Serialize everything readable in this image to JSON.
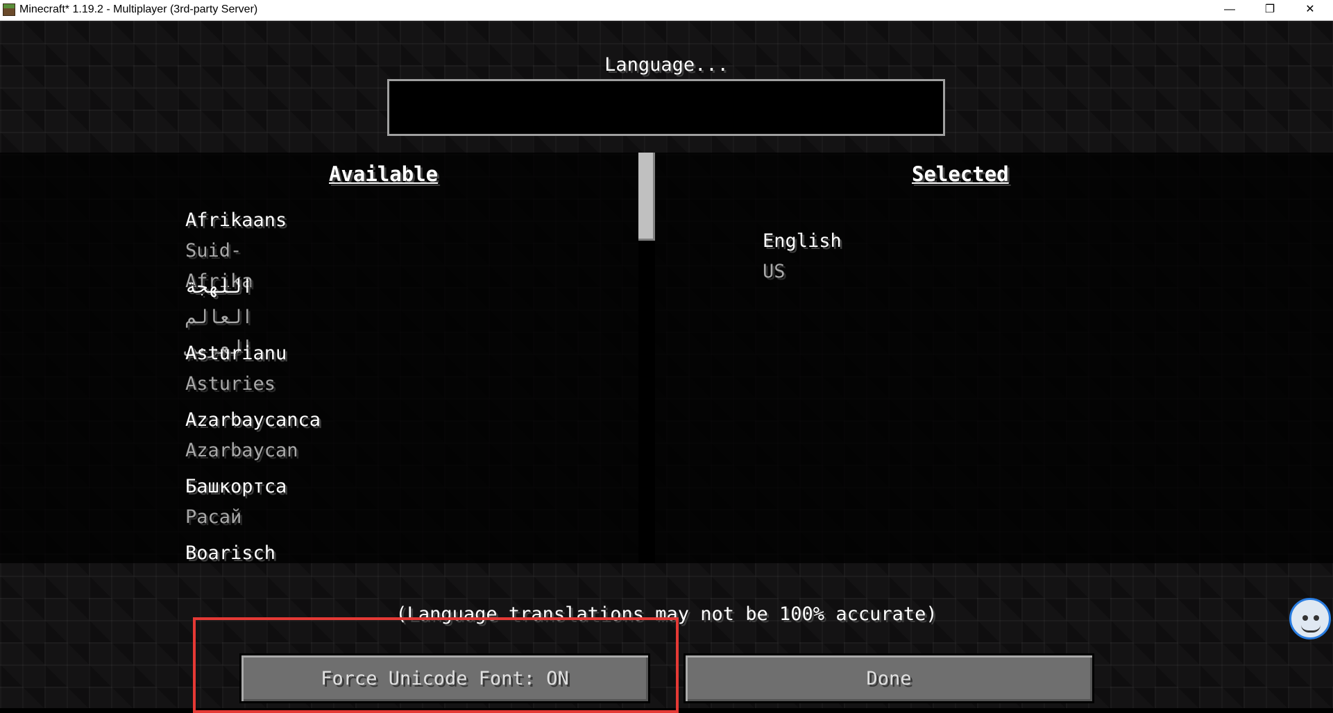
{
  "window": {
    "title": "Minecraft* 1.19.2 - Multiplayer (3rd-party Server)",
    "minimize_glyph": "—",
    "maximize_glyph": "❐",
    "close_glyph": "✕"
  },
  "screen": {
    "title": "Language...",
    "search": {
      "value": "",
      "placeholder": ""
    },
    "available_header": "Available",
    "selected_header": "Selected",
    "available": [
      {
        "name": "Afrikaans",
        "region": "Suid-Afrika"
      },
      {
        "name": "اللهجة",
        "region": "العالم العربي"
      },
      {
        "name": "Asturianu",
        "region": "Asturies"
      },
      {
        "name": "Azarbaycanca",
        "region": "Azarbaycan"
      },
      {
        "name": "Башкортса",
        "region": "Расай"
      },
      {
        "name": "Boarisch",
        "region": ""
      }
    ],
    "selected": [
      {
        "name": "English",
        "region": "US"
      }
    ],
    "note": "(Language translations may not be 100% accurate)",
    "buttons": {
      "force_unicode": "Force Unicode Font: ON",
      "done": "Done"
    }
  },
  "colors": {
    "highlight": "#e53935",
    "button": "#6f6f6f",
    "region_text": "#a8a8a8"
  }
}
